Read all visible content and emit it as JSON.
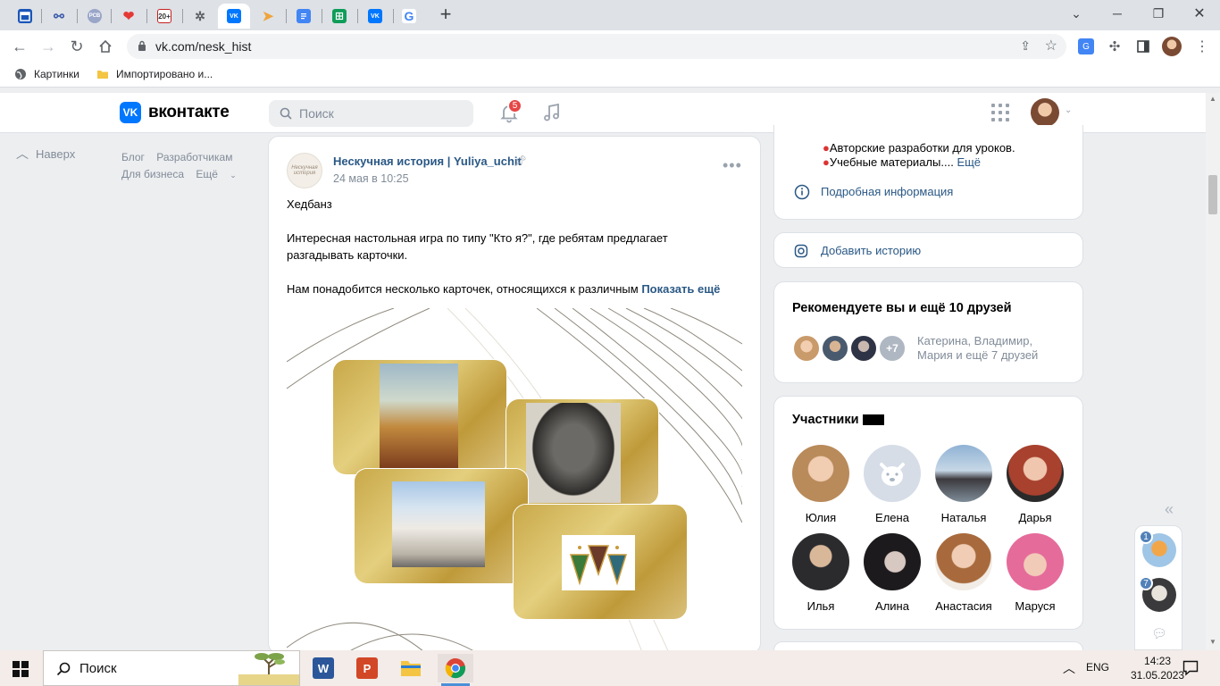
{
  "browser": {
    "tabs": [
      {
        "icon": "calendar-icon",
        "color": "#1a56b8"
      },
      {
        "icon": "network-icon",
        "color": "#3b5bab"
      },
      {
        "icon": "rcb-icon",
        "color": "#9aa6c8",
        "text": "РСВ"
      },
      {
        "icon": "heart-icon",
        "color": "#e53935"
      },
      {
        "icon": "gmail-20-icon",
        "color": "#444",
        "text": "20+"
      },
      {
        "icon": "loading-icon",
        "color": "#5f6368"
      },
      {
        "icon": "vk-icon",
        "color": "#0077ff",
        "text": "VK"
      },
      {
        "icon": "paper-plane-icon",
        "color": "#f0a33a"
      },
      {
        "icon": "docs-icon",
        "color": "#4285f4"
      },
      {
        "icon": "sheets-icon",
        "color": "#0f9d58"
      },
      {
        "icon": "vk-icon",
        "color": "#0077ff",
        "text": "VK"
      },
      {
        "icon": "google-icon",
        "color": "#fff",
        "text": "G"
      }
    ],
    "url": "vk.com/nesk_hist",
    "bookmarks": [
      {
        "label": "Картинки",
        "icon": "globe-icon"
      },
      {
        "label": "Импортировано и...",
        "icon": "folder-icon"
      }
    ]
  },
  "vk": {
    "logo_text": "вконтакте",
    "logo_mark": "VK",
    "search_placeholder": "Поиск",
    "notifications_count": "5",
    "up_label": "Наверх",
    "footer_links": [
      "Блог",
      "Разработчикам",
      "Для бизнеса",
      "Ещё"
    ]
  },
  "post": {
    "avatar_text": "Нескучная история",
    "author": "Нескучная история | Yuliya_uchit",
    "date": "24 мая в 10:25",
    "paragraphs": [
      "Хедбанз",
      "Интересная настольная игра по типу \"Кто я?\", где ребятам предлагает разгадывать карточки.",
      "Нам понадобится несколько карточек, относящихся к различным"
    ],
    "show_more": "Показать ещё"
  },
  "sidebar": {
    "about_lines": [
      "Авторские разработки для уроков.",
      "Учебные материалы...."
    ],
    "about_more": "Ещё",
    "details_link": "Подробная информация",
    "add_story": "Добавить историю",
    "recommend_title": "Рекомендуете вы и ещё 10 друзей",
    "recommend_plus": "+7",
    "recommend_names": "Катерина, Владимир,",
    "recommend_names2": "Мария и ещё 7 друзей",
    "members_title": "Участники",
    "members": [
      "Юлия",
      "Елена",
      "Наталья",
      "Дарья",
      "Илья",
      "Алина",
      "Анастасия",
      "Маруся"
    ]
  },
  "chat": {
    "badges": [
      "1",
      "7"
    ]
  },
  "taskbar": {
    "search_label": "Поиск",
    "lang": "ENG",
    "time": "14:23",
    "date": "31.05.2023"
  }
}
